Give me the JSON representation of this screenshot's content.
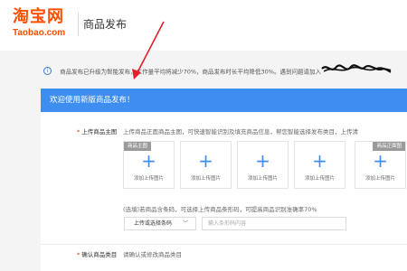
{
  "header": {
    "logo_main": "淘宝网",
    "logo_sub": "Taobao.com",
    "page_title": "商品发布"
  },
  "notice": {
    "icon": "info-icon",
    "text": "商品发布已升级为智能发布，工作量平均将减少70%，商品发布时长平均降低30%。遇到问题请加入"
  },
  "panel": {
    "title": "欢迎使用新版商品发布！",
    "main_image": {
      "label": "上传商品主图",
      "hint": "上传商品正面商品主图，可快速智能识别及填充商品信息，帮您智能选择发布类目，上传清",
      "slots": [
        {
          "tag": "商品主图",
          "label": "添加上传图片"
        },
        {
          "tag": "",
          "label": "添加上传图片"
        },
        {
          "tag": "",
          "label": "添加上传图片"
        },
        {
          "tag": "",
          "label": "添加上传图片"
        },
        {
          "tag": "商品正面图",
          "label": "添加上传图片"
        }
      ]
    },
    "barcode": {
      "hint": "(选填)若商品含条码，可选择上传商品条形码，可提高商品识别准确率70%",
      "select_label": "上传或选择条码",
      "input_placeholder": "输入条形码内容"
    },
    "category": {
      "label": "确认商品类目",
      "hint": "请确认或修改商品类目"
    }
  },
  "colors": {
    "brand": "#ff5000",
    "panel_header": "#3e8ef1",
    "annotation": "#e0202a"
  }
}
